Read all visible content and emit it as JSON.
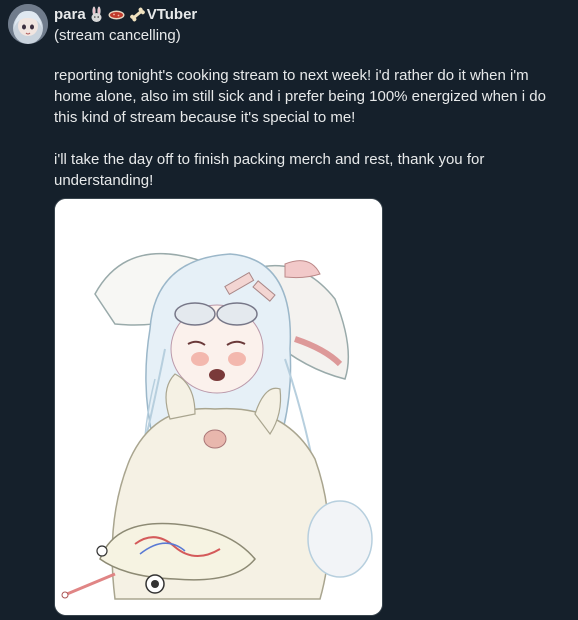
{
  "post": {
    "author": {
      "display_name": "para",
      "suffix_label": "VTuber",
      "avatar_alt": "avatar",
      "emoji_icons": [
        "rabbit-icon",
        "sausage-icon",
        "bone-icon"
      ]
    },
    "subtitle": "(stream cancelling)",
    "paragraphs": [
      "reporting tonight's cooking stream to next week! i'd rather do it when i'm home alone, also im still sick and i prefer being 100% energized when i do this kind of stream because it's special to me!",
      "i'll take the day off to finish packing merch and rest, thank you for understanding!"
    ]
  },
  "colors": {
    "background": "#15202b",
    "text": "#e7e9ea",
    "media_border": "#38444d"
  }
}
